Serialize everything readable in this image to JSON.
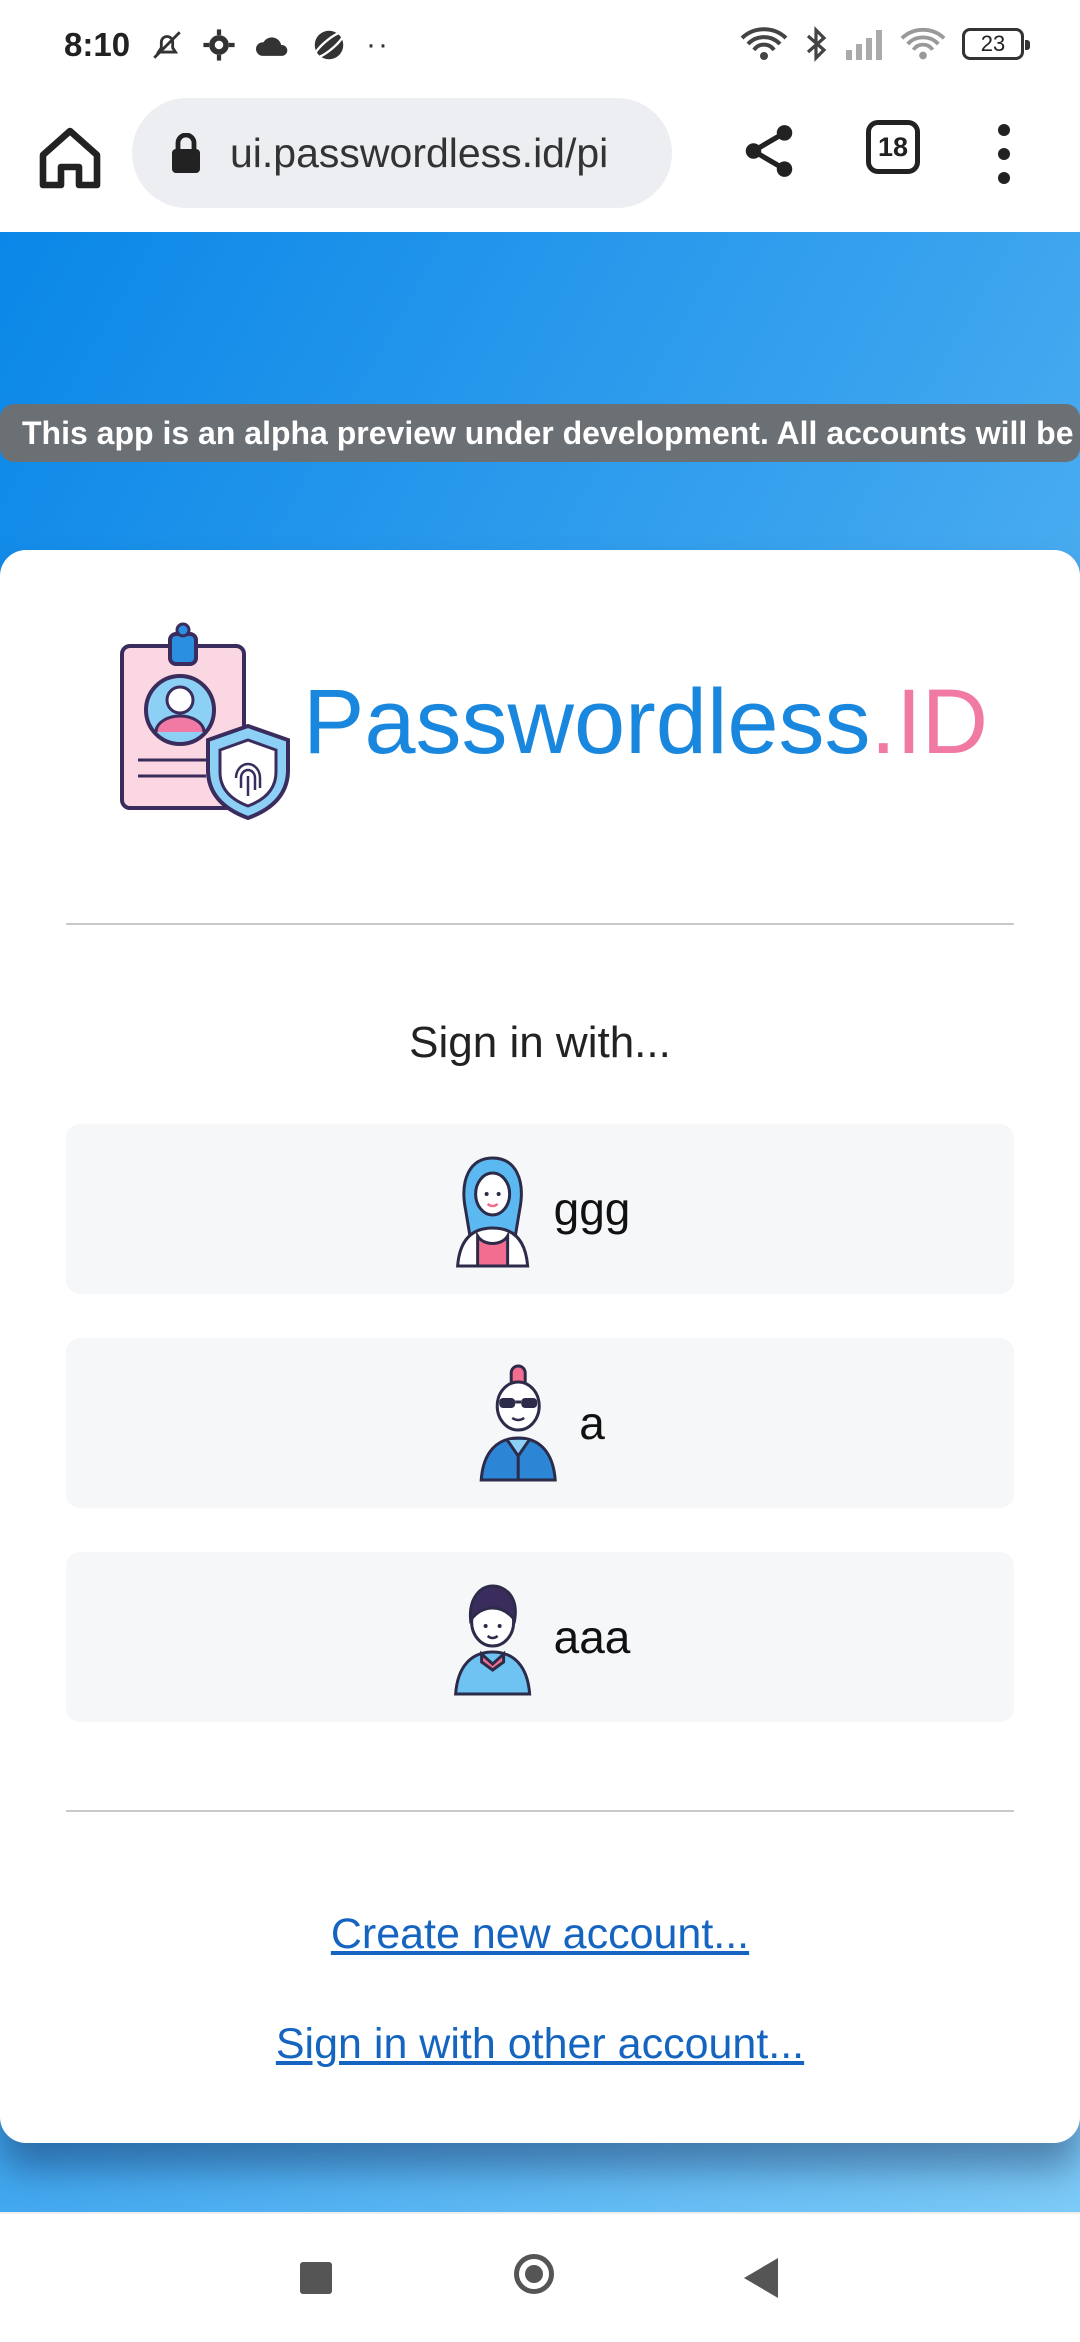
{
  "status_bar": {
    "time": "8:10",
    "left_icons": [
      "bell-off-icon",
      "gear-icon",
      "cloud-icon",
      "planet-icon"
    ],
    "more_dots": "··",
    "right_icons": [
      "wifi-icon",
      "bluetooth-icon",
      "signal-icon",
      "wifi-secondary-icon"
    ],
    "battery_level": "23"
  },
  "browser": {
    "url": "ui.passwordless.id/pi",
    "tab_count": "18",
    "icons": [
      "home-icon",
      "lock-icon",
      "share-icon",
      "tabs-icon",
      "more-vert-icon"
    ]
  },
  "banner": {
    "text": "This app is an alpha preview under development. All accounts will be de"
  },
  "logo": {
    "word_main": "Passwordless",
    "word_accent": ".ID",
    "colors": {
      "main": "#1a87de",
      "accent": "#f07aa4"
    }
  },
  "signin": {
    "heading": "Sign in with...",
    "accounts": [
      {
        "name": "ggg",
        "avatar": "woman-avatar-icon"
      },
      {
        "name": "a",
        "avatar": "punk-sunglasses-avatar-icon"
      },
      {
        "name": "aaa",
        "avatar": "boy-avatar-icon"
      }
    ]
  },
  "links": {
    "create": "Create new account...",
    "other": "Sign in with other account..."
  },
  "nav": {
    "icons": [
      "recents-square-icon",
      "home-circle-icon",
      "back-triangle-icon"
    ]
  }
}
